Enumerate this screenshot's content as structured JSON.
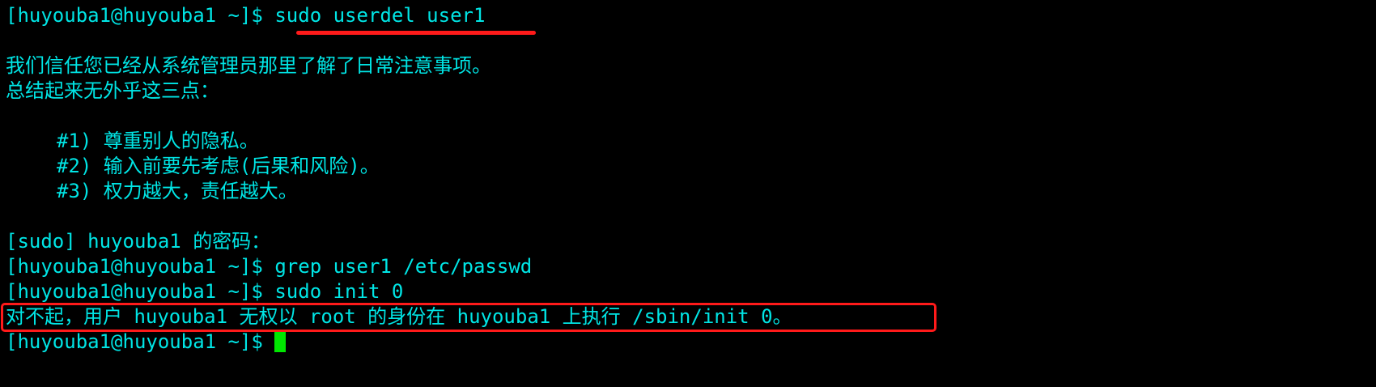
{
  "terminal": {
    "colors": {
      "background": "#000000",
      "text": "#00e5e5",
      "cursor": "#00e600",
      "annotation": "#ff1a1a"
    },
    "lines": [
      {
        "prompt": "[huyouba1@huyouba1 ~]$ ",
        "command": "sudo userdel user1"
      },
      {
        "text": ""
      },
      {
        "text": "我们信任您已经从系统管理员那里了解了日常注意事项。"
      },
      {
        "text": "总结起来无外乎这三点："
      },
      {
        "text": ""
      },
      {
        "text": "#1) 尊重别人的隐私。"
      },
      {
        "text": "#2) 输入前要先考虑(后果和风险)。"
      },
      {
        "text": "#3) 权力越大，责任越大。"
      },
      {
        "text": ""
      },
      {
        "text": "[sudo] huyouba1 的密码："
      },
      {
        "prompt": "[huyouba1@huyouba1 ~]$ ",
        "command": "grep user1 /etc/passwd"
      },
      {
        "prompt": "[huyouba1@huyouba1 ~]$ ",
        "command": "sudo init 0"
      },
      {
        "text": "对不起，用户 huyouba1 无权以 root 的身份在 huyouba1 上执行 /sbin/init 0。"
      },
      {
        "prompt": "[huyouba1@huyouba1 ~]$ ",
        "command": ""
      }
    ],
    "annotations": {
      "underline_target": "sudo userdel user1",
      "box_target": "对不起，用户 huyouba1 无权以 root 的身份在 huyouba1 上执行 /sbin/init 0。"
    }
  }
}
